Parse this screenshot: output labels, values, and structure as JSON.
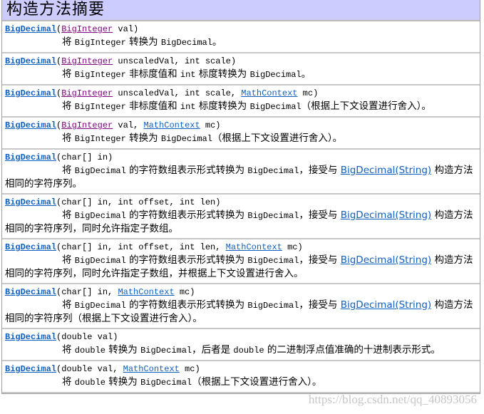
{
  "title": "构造方法摘要",
  "watermark": "https://blog.csdn.net/qq_40893056",
  "rows": [
    {
      "sig": [
        [
          "c",
          "BigDecimal"
        ],
        [
          "t",
          "("
        ],
        [
          "k",
          "BigInteger"
        ],
        [
          "t",
          " val)"
        ]
      ],
      "desc": [
        [
          "z",
          "将 "
        ],
        [
          "m",
          "BigInteger"
        ],
        [
          "z",
          " 转换为 "
        ],
        [
          "m",
          "BigDecimal"
        ],
        [
          "z",
          "。"
        ]
      ]
    },
    {
      "sig": [
        [
          "c",
          "BigDecimal"
        ],
        [
          "t",
          "("
        ],
        [
          "k",
          "BigInteger"
        ],
        [
          "t",
          " unscaledVal, int scale)"
        ]
      ],
      "desc": [
        [
          "z",
          "将 "
        ],
        [
          "m",
          "BigInteger"
        ],
        [
          "z",
          " 非标度值和 "
        ],
        [
          "m",
          "int"
        ],
        [
          "z",
          " 标度转换为 "
        ],
        [
          "m",
          "BigDecimal"
        ],
        [
          "z",
          "。"
        ]
      ]
    },
    {
      "sig": [
        [
          "c",
          "BigDecimal"
        ],
        [
          "t",
          "("
        ],
        [
          "k",
          "BigInteger"
        ],
        [
          "t",
          " unscaledVal, int scale, "
        ],
        [
          "l",
          "MathContext"
        ],
        [
          "t",
          " mc)"
        ]
      ],
      "desc": [
        [
          "z",
          "将 "
        ],
        [
          "m",
          "BigInteger"
        ],
        [
          "z",
          " 非标度值和 "
        ],
        [
          "m",
          "int"
        ],
        [
          "z",
          " 标度转换为 "
        ],
        [
          "m",
          "BigDecimal"
        ],
        [
          "z",
          "（根据上下文设置进行舍入）。"
        ]
      ]
    },
    {
      "sig": [
        [
          "c",
          "BigDecimal"
        ],
        [
          "t",
          "("
        ],
        [
          "k",
          "BigInteger"
        ],
        [
          "t",
          " val, "
        ],
        [
          "l",
          "MathContext"
        ],
        [
          "t",
          " mc)"
        ]
      ],
      "desc": [
        [
          "z",
          "将 "
        ],
        [
          "m",
          "BigInteger"
        ],
        [
          "z",
          " 转换为 "
        ],
        [
          "m",
          "BigDecimal"
        ],
        [
          "z",
          "（根据上下文设置进行舍入）。"
        ]
      ]
    },
    {
      "sig": [
        [
          "c",
          "BigDecimal"
        ],
        [
          "t",
          "(char[] in)"
        ]
      ],
      "desc": [
        [
          "z",
          "将 "
        ],
        [
          "m",
          "BigDecimal"
        ],
        [
          "z",
          " 的字符数组表示形式转换为 "
        ],
        [
          "m",
          "BigDecimal"
        ],
        [
          "z",
          "，接受与 "
        ],
        [
          "l",
          "BigDecimal(String)"
        ],
        [
          "z",
          " 构造方法相同的字符序列。"
        ]
      ]
    },
    {
      "sig": [
        [
          "c",
          "BigDecimal"
        ],
        [
          "t",
          "(char[] in, int offset, int len)"
        ]
      ],
      "desc": [
        [
          "z",
          "将 "
        ],
        [
          "m",
          "BigDecimal"
        ],
        [
          "z",
          " 的字符数组表示形式转换为 "
        ],
        [
          "m",
          "BigDecimal"
        ],
        [
          "z",
          "，接受与 "
        ],
        [
          "l",
          "BigDecimal(String)"
        ],
        [
          "z",
          " 构造方法相同的字符序列，同时允许指定子数组。"
        ]
      ]
    },
    {
      "sig": [
        [
          "c",
          "BigDecimal"
        ],
        [
          "t",
          "(char[] in, int offset, int len, "
        ],
        [
          "l",
          "MathContext"
        ],
        [
          "t",
          " mc)"
        ]
      ],
      "desc": [
        [
          "z",
          "将 "
        ],
        [
          "m",
          "BigDecimal"
        ],
        [
          "z",
          " 的字符数组表示形式转换为 "
        ],
        [
          "m",
          "BigDecimal"
        ],
        [
          "z",
          "，接受与 "
        ],
        [
          "l",
          "BigDecimal(String)"
        ],
        [
          "z",
          " 构造方法相同的字符序列，同时允许指定子数组，并根据上下文设置进行舍入。"
        ]
      ]
    },
    {
      "sig": [
        [
          "c",
          "BigDecimal"
        ],
        [
          "t",
          "(char[] in, "
        ],
        [
          "l",
          "MathContext"
        ],
        [
          "t",
          " mc)"
        ]
      ],
      "desc": [
        [
          "z",
          "将 "
        ],
        [
          "m",
          "BigDecimal"
        ],
        [
          "z",
          " 的字符数组表示形式转换为 "
        ],
        [
          "m",
          "BigDecimal"
        ],
        [
          "z",
          "，接受与 "
        ],
        [
          "l",
          "BigDecimal(String)"
        ],
        [
          "z",
          " 构造方法相同的字符序列（根据上下文设置进行舍入）。"
        ]
      ]
    },
    {
      "sig": [
        [
          "c",
          "BigDecimal"
        ],
        [
          "t",
          "(double val)"
        ]
      ],
      "desc": [
        [
          "z",
          "将 "
        ],
        [
          "m",
          "double"
        ],
        [
          "z",
          " 转换为 "
        ],
        [
          "m",
          "BigDecimal"
        ],
        [
          "z",
          "，后者是 "
        ],
        [
          "m",
          "double"
        ],
        [
          "z",
          " 的二进制浮点值准确的十进制表示形式。"
        ]
      ]
    },
    {
      "sig": [
        [
          "c",
          "BigDecimal"
        ],
        [
          "t",
          "(double val, "
        ],
        [
          "l",
          "MathContext"
        ],
        [
          "t",
          " mc)"
        ]
      ],
      "desc": [
        [
          "z",
          "将 "
        ],
        [
          "m",
          "double"
        ],
        [
          "z",
          " 转换为 "
        ],
        [
          "m",
          "BigDecimal"
        ],
        [
          "z",
          "（根据上下文设置进行舍入）。"
        ]
      ]
    }
  ]
}
